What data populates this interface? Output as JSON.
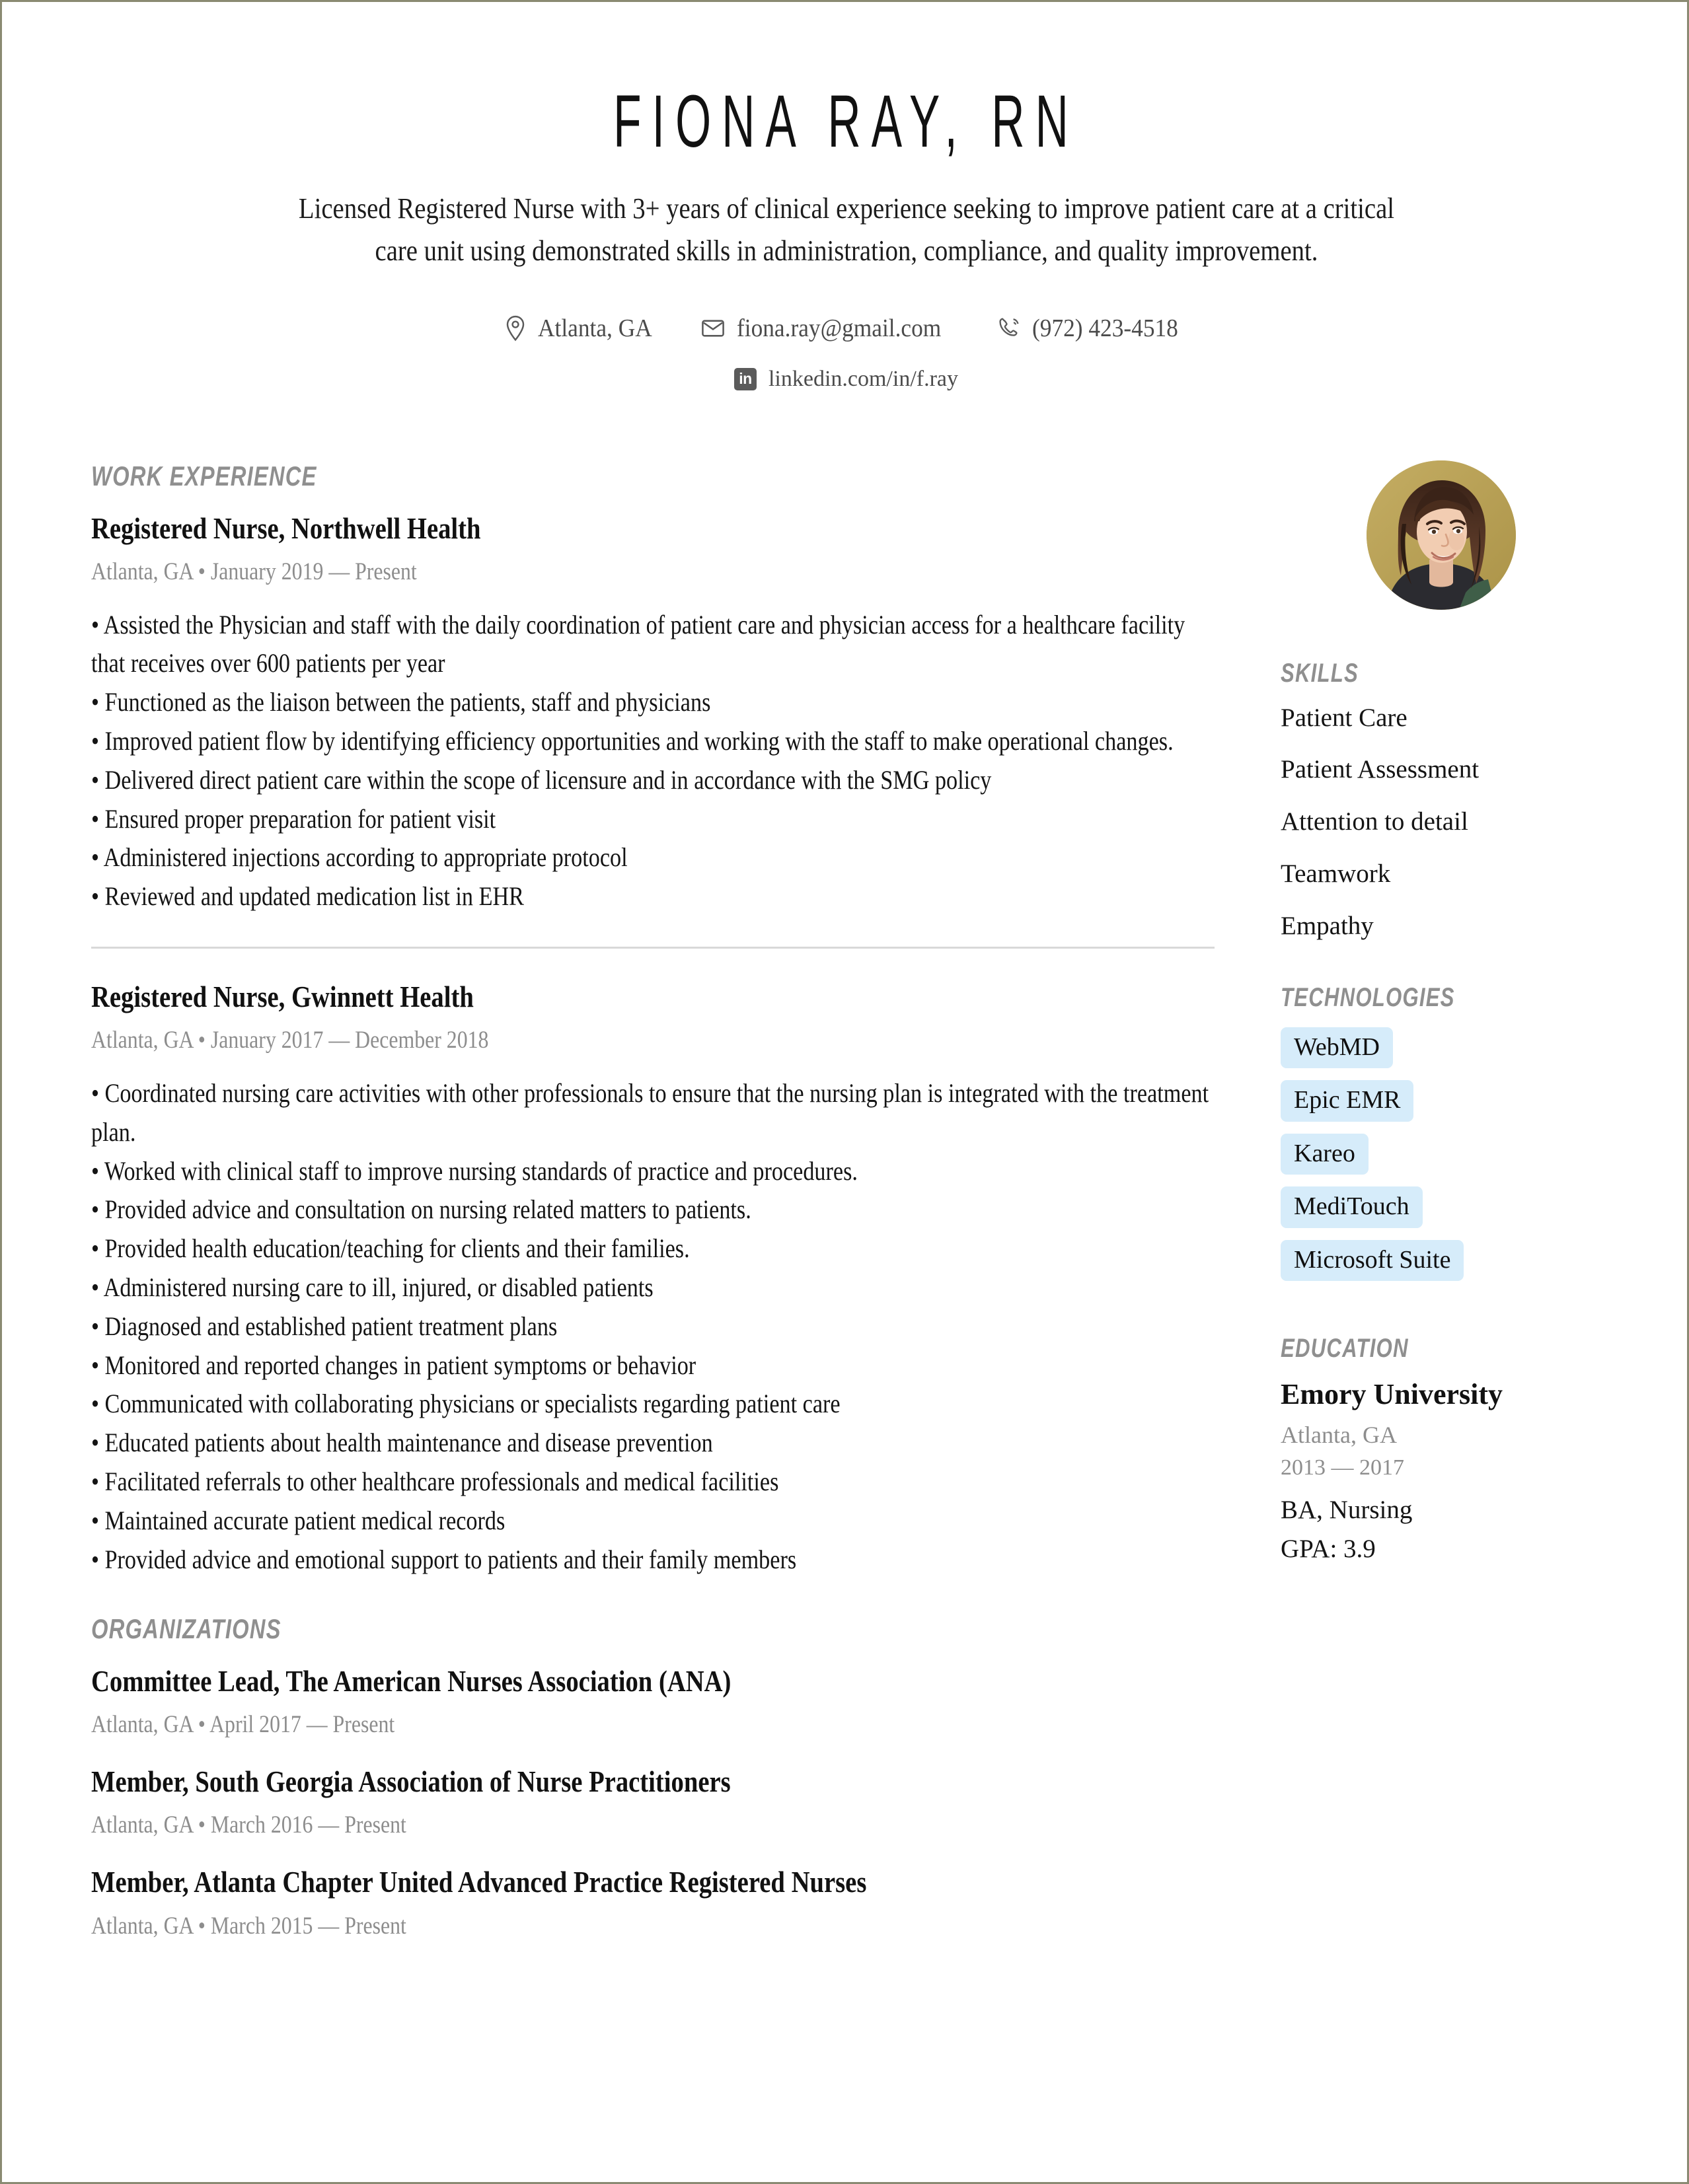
{
  "header": {
    "name": "FIONA RAY, RN",
    "summary": "Licensed Registered Nurse with 3+ years of clinical experience seeking to improve patient care at a critical care unit using demonstrated skills in administration, compliance, and quality improvement.",
    "contacts": [
      {
        "icon": "location-pin-icon",
        "value": "Atlanta, GA"
      },
      {
        "icon": "envelope-icon",
        "value": "fiona.ray@gmail.com"
      },
      {
        "icon": "phone-icon",
        "value": "(972) 423-4518"
      }
    ],
    "linkedin": {
      "icon": "linkedin-icon",
      "badge": "in",
      "value": "linkedin.com/in/f.ray"
    }
  },
  "sections": {
    "work_experience": {
      "heading": "WORK EXPERIENCE",
      "jobs": [
        {
          "title": "Registered Nurse, Northwell Health",
          "meta": "Atlanta, GA • January 2019 — Present",
          "bullets": [
            "• Assisted the Physician and staff with the daily coordination of patient care and physician access for a healthcare facility that receives over 600 patients per year",
            "• Functioned as the liaison between the patients, staff and physicians",
            "• Improved patient flow by identifying efficiency opportunities and working with the staff to make operational changes.",
            "• Delivered direct patient care within the scope of licensure and in accordance with the SMG policy",
            "• Ensured proper preparation for patient visit",
            "• Administered injections according to appropriate protocol",
            "• Reviewed and updated medication list in EHR"
          ]
        },
        {
          "title": "Registered Nurse, Gwinnett Health",
          "meta": "Atlanta, GA • January 2017 — December 2018",
          "bullets": [
            "• Coordinated nursing care activities with other professionals to ensure that the nursing plan is integrated with the treatment plan.",
            "• Worked with clinical staff to improve nursing standards of practice and procedures.",
            "• Provided advice and consultation on nursing related matters to patients.",
            "• Provided health education/teaching for clients and their families.",
            "• Administered nursing care to ill, injured, or disabled patients",
            "• Diagnosed and established patient treatment plans",
            "• Monitored and reported changes in patient symptoms or behavior",
            "• Communicated with collaborating physicians or specialists regarding patient care",
            "• Educated patients about health maintenance and disease prevention",
            "• Facilitated referrals to other healthcare professionals and medical facilities",
            "• Maintained accurate patient medical records",
            "• Provided advice and emotional support to patients and their family members"
          ]
        }
      ]
    },
    "organizations": {
      "heading": "ORGANIZATIONS",
      "items": [
        {
          "title": "Committee Lead, The American Nurses Association (ANA)",
          "meta": "Atlanta, GA • April 2017 — Present"
        },
        {
          "title": "Member, South Georgia Association of Nurse Practitioners",
          "meta": "Atlanta, GA • March 2016 — Present"
        },
        {
          "title": "Member, Atlanta Chapter United Advanced Practice Registered Nurses",
          "meta": "Atlanta, GA • March 2015 — Present"
        }
      ]
    },
    "skills": {
      "heading": "SKILLS",
      "items": [
        "Patient Care",
        "Patient Assessment",
        "Attention to detail",
        "Teamwork",
        "Empathy"
      ]
    },
    "technologies": {
      "heading": "TECHNOLOGIES",
      "items": [
        "WebMD",
        "Epic EMR",
        "Kareo",
        "MediTouch",
        "Microsoft Suite"
      ]
    },
    "education": {
      "heading": "EDUCATION",
      "school": "Emory University",
      "location": "Atlanta, GA",
      "years": "2013 — 2017",
      "degree": "BA, Nursing",
      "gpa": "GPA: 3.9"
    }
  },
  "colors": {
    "page_border": "#8a8a72",
    "section_heading": "#8f8f8f",
    "meta_text": "#8d8d8d",
    "tag_background": "#d6ecfa",
    "divider": "#d8d8d8",
    "linkedin_badge": "#5b5b5b"
  },
  "avatar": {
    "alt": "profile-photo"
  }
}
